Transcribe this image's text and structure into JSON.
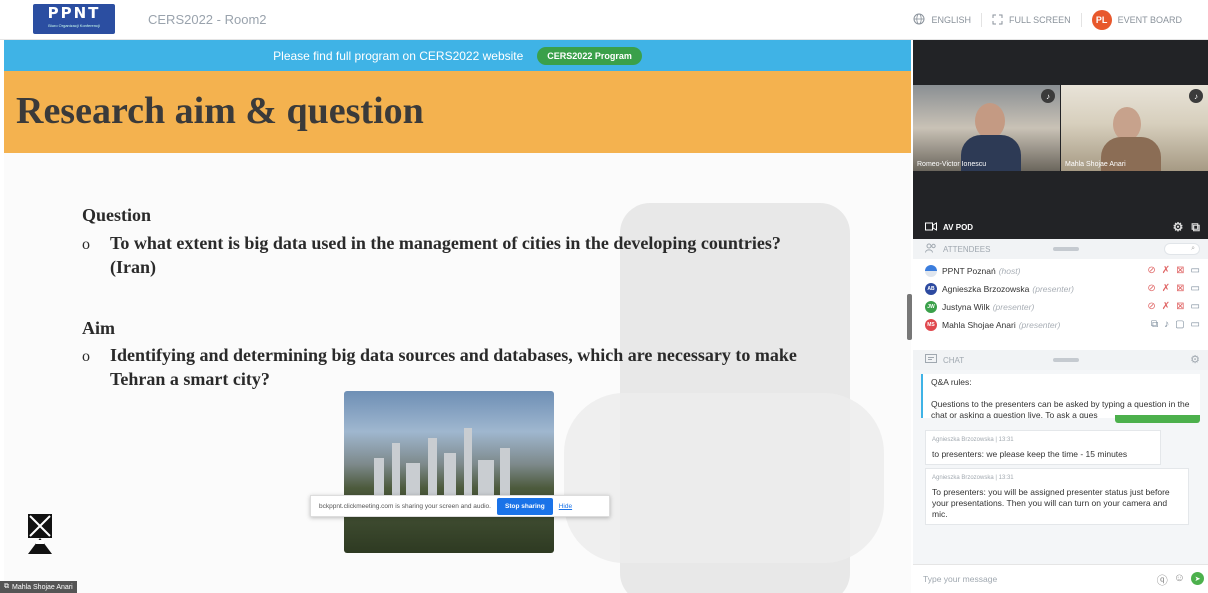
{
  "app": {
    "logo": "PPNT",
    "logo_sub": "Biuro Organizacji Konferencji",
    "room": "CERS2022 - Room2"
  },
  "top_menu": {
    "language": "ENGLISH",
    "fullscreen": "FULL SCREEN",
    "avatar": "PL",
    "event_board": "EVENT BOARD"
  },
  "banner": {
    "text": "Please find full program on CERS2022 website",
    "button": "CERS2022 Program"
  },
  "slide": {
    "title": "Research aim & question",
    "question_head": "Question",
    "question_bullet": "o",
    "question_line1": "To what extent is big data used in the management of cities in the developing countries?",
    "question_line2": "(Iran)",
    "aim_head": "Aim",
    "aim_bullet": "o",
    "aim_line1": "Identifying and determining big data sources and databases, which are necessary to make",
    "aim_line2": "Tehran a smart city?"
  },
  "share_bar": {
    "text": "bckppnt.clickmeeting.com is sharing your screen and audio.",
    "stop": "Stop sharing",
    "hide": "Hide"
  },
  "speaker_tag": "Mahla Shojae Anari",
  "videos": [
    {
      "name": "Romeo-Victor Ionescu"
    },
    {
      "name": "Mahla Shojae Anari"
    }
  ],
  "av_pod": {
    "label": "AV POD"
  },
  "attendees": {
    "label": "ATTENDEES",
    "list": [
      {
        "name": "PPNT Poznań",
        "role": "(host)",
        "initials": "",
        "color": "#3b7ddd"
      },
      {
        "name": "Agnieszka Brzozowska",
        "role": "(presenter)",
        "initials": "AB",
        "color": "#2d4aa0"
      },
      {
        "name": "Justyna Wilk",
        "role": "(presenter)",
        "initials": "JW",
        "color": "#3aa04a"
      },
      {
        "name": "Mahla Shojae Anari",
        "role": "(presenter)",
        "initials": "MS",
        "color": "#e0484e"
      }
    ]
  },
  "chat": {
    "label": "CHAT",
    "rules_title": "Q&A rules:",
    "rules_text": "Questions to the presenters can be asked by typing a question in the chat or asking a question live. To ask a ques",
    "messages": [
      {
        "author": "Agnieszka Brzozowska",
        "time": "13:31",
        "text": "to presenters: we please keep the time - 15 minutes"
      },
      {
        "author": "Agnieszka Brzozowska",
        "time": "13:31",
        "text": "To presenters: you will be assigned presenter status just before your presentations. Then you will can turn on your camera and mic."
      }
    ],
    "input_placeholder": "Type your message"
  },
  "colors": {
    "banner": "#3fb3e6",
    "title_bar": "#f4b24f",
    "green": "#4cb04c",
    "avatar_pl": "#e8582c",
    "dark_panel": "#222326"
  }
}
